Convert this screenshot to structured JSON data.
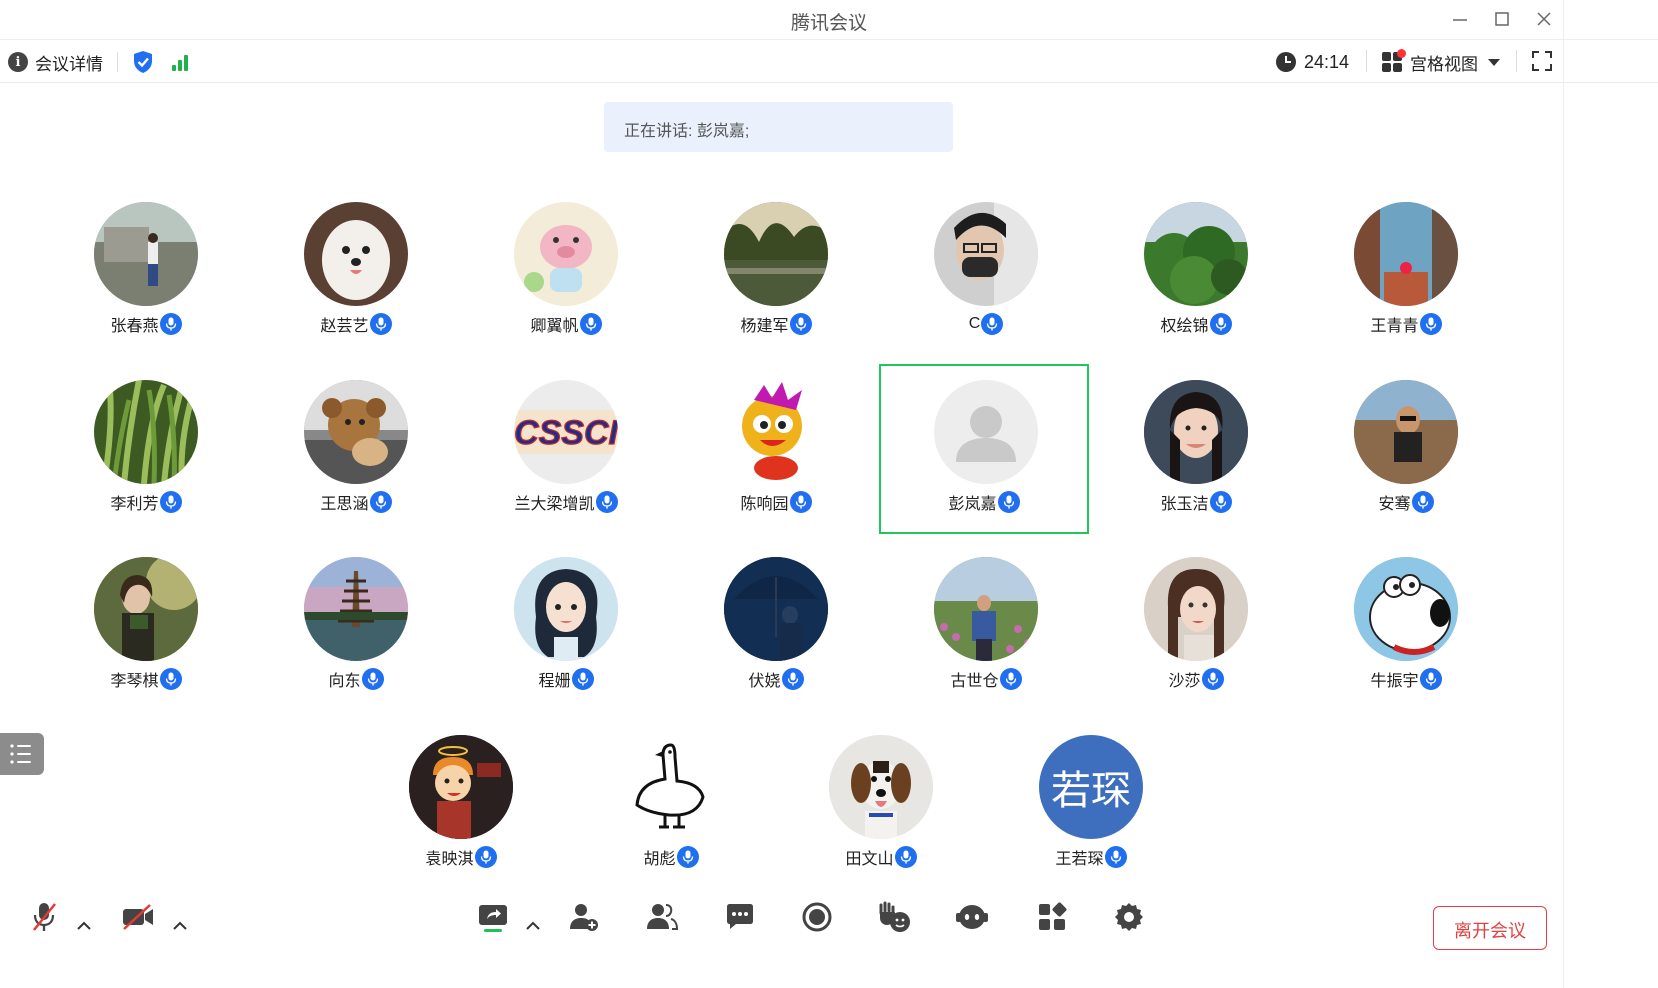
{
  "window": {
    "title": "腾讯会议"
  },
  "infobar": {
    "details_label": "会议详情",
    "timer": "24:14",
    "view_label": "宫格视图"
  },
  "speaking": {
    "text": "正在讲话: 彭岚嘉;"
  },
  "participants": [
    {
      "name": "张春燕",
      "avatar": "photo-woman-garden"
    },
    {
      "name": "赵芸艺",
      "avatar": "photo-white-dog"
    },
    {
      "name": "卿翼帆",
      "avatar": "cartoon-pig"
    },
    {
      "name": "杨建军",
      "avatar": "photo-lake-trees"
    },
    {
      "name": "C",
      "avatar": "photo-man-mask"
    },
    {
      "name": "权绘锦",
      "avatar": "photo-plants"
    },
    {
      "name": "王青青",
      "avatar": "photo-seaside"
    },
    {
      "name": "李利芳",
      "avatar": "photo-rice-plants"
    },
    {
      "name": "王思涵",
      "avatar": "photo-teddy-bear"
    },
    {
      "name": "兰大梁增凯",
      "avatar": "logo-cssci",
      "logo_text": "CSSCI"
    },
    {
      "name": "陈响园",
      "avatar": "cartoon-dragon"
    },
    {
      "name": "彭岚嘉",
      "avatar": "default-person",
      "speaking": true
    },
    {
      "name": "张玉洁",
      "avatar": "photo-young-woman"
    },
    {
      "name": "安骞",
      "avatar": "photo-man-rocks"
    },
    {
      "name": "李琴棋",
      "avatar": "photo-woman-reading"
    },
    {
      "name": "向东",
      "avatar": "photo-pagoda"
    },
    {
      "name": "程姗",
      "avatar": "illustration-girl"
    },
    {
      "name": "伏娆",
      "avatar": "photo-umbrella-night"
    },
    {
      "name": "古世仓",
      "avatar": "photo-man-flowers"
    },
    {
      "name": "沙莎",
      "avatar": "photo-woman-portrait"
    },
    {
      "name": "牛振宇",
      "avatar": "cartoon-dog"
    },
    {
      "name": "袁映淇",
      "avatar": "cartoon-boy-angel"
    },
    {
      "name": "胡彪",
      "avatar": "sketch-goose"
    },
    {
      "name": "田文山",
      "avatar": "photo-beagle"
    },
    {
      "name": "王若琛",
      "avatar": "initials",
      "initials": "若琛"
    }
  ],
  "toolbar": {
    "leave_label": "离开会议",
    "icons": [
      "mic-muted-icon",
      "camera-off-icon",
      "share-screen-icon",
      "invite-icon",
      "members-icon",
      "chat-icon",
      "record-icon",
      "raise-hand-icon",
      "assistant-icon",
      "apps-icon",
      "settings-icon"
    ]
  },
  "colors": {
    "accent": "#1f6ff0",
    "active_border": "#22c55e",
    "leave": "#e34141",
    "signal": "#20b24a"
  }
}
